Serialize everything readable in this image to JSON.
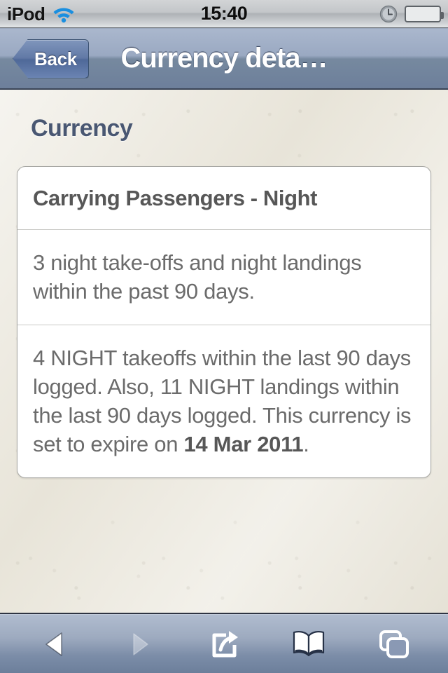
{
  "status_bar": {
    "carrier": "iPod",
    "wifi_icon": "wifi-icon",
    "time": "15:40",
    "alarm_icon": "alarm-clock-icon",
    "battery_icon": "battery-full-icon",
    "battery_level": 100
  },
  "nav_bar": {
    "back_label": "Back",
    "title": "Currency deta…"
  },
  "content": {
    "section_title": "Currency",
    "card": {
      "rows": [
        {
          "kind": "title",
          "text": "Carrying Passengers - Night"
        },
        {
          "kind": "body",
          "text": "3 night take-offs and night landings within the past 90 days."
        },
        {
          "kind": "body_rich",
          "prefix": "4 NIGHT takeoffs within the last 90 days logged. Also, 11 NIGHT landings within the last 90 days logged. This currency is set to expire on ",
          "emphasis": "14 Mar 2011",
          "suffix": "."
        }
      ]
    }
  },
  "toolbar": {
    "buttons": [
      {
        "name": "back-button",
        "icon": "triangle-left-icon",
        "state": "enabled"
      },
      {
        "name": "forward-button",
        "icon": "triangle-right-icon",
        "state": "disabled"
      },
      {
        "name": "share-button",
        "icon": "share-icon",
        "state": "enabled"
      },
      {
        "name": "bookmarks-button",
        "icon": "book-icon",
        "state": "enabled"
      },
      {
        "name": "tabs-button",
        "icon": "pages-icon",
        "state": "enabled"
      }
    ]
  },
  "colors": {
    "nav_bar_top": "#aab7cd",
    "nav_bar_bottom": "#6d7f9b",
    "section_title": "#495772",
    "page_background": "#ece9df",
    "card_background": "#ffffff",
    "body_text": "#6b6b6b",
    "battery_green": "#55cc14",
    "wifi_blue": "#1a8fe0"
  }
}
